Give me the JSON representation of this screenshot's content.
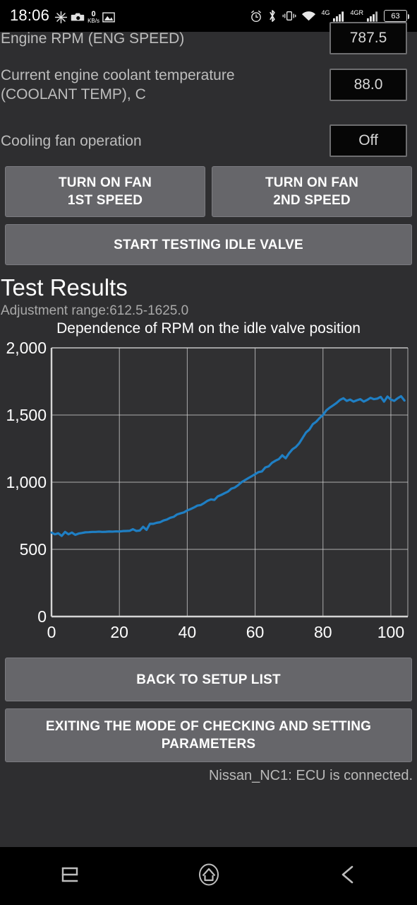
{
  "statusbar": {
    "time": "18:06",
    "network_speed_value": "0",
    "network_speed_unit": "KB/s",
    "battery_percent": "63",
    "mobile_label_1": "4G",
    "mobile_label_2": "4GR",
    "icons": [
      "burst-icon",
      "camera-icon",
      "network-speed-icon",
      "image-icon",
      "alarm-icon",
      "bluetooth-icon",
      "vibrate-icon",
      "wifi-icon",
      "signal-bars-icon",
      "battery-icon"
    ]
  },
  "params": [
    {
      "label": "Engine RPM (ENG SPEED)",
      "value": "787.5"
    },
    {
      "label": "Current engine coolant temperature (COOLANT TEMP), C",
      "value": "88.0"
    },
    {
      "label": "Cooling fan operation",
      "value": "Off"
    }
  ],
  "buttons": {
    "fan1_line1": "TURN ON FAN",
    "fan1_line2": "1ST SPEED",
    "fan2_line1": "TURN ON FAN",
    "fan2_line2": "2ND SPEED",
    "start_test": "START TESTING IDLE VALVE",
    "back_to_setup": "BACK TO SETUP LIST",
    "exit_line1": "EXITING THE MODE OF CHECKING AND SETTING",
    "exit_line2": "PARAMETERS"
  },
  "results": {
    "title": "Test Results",
    "adjustment_range": "Adjustment range:612.5-1625.0"
  },
  "footer": {
    "status": "Nissan_NC1: ECU is connected."
  },
  "navbar": {
    "recents": "recents-icon",
    "home": "home-icon",
    "back": "back-icon"
  },
  "colors": {
    "background": "#2e2e30",
    "button": "#66666a",
    "line": "#1f7fc4",
    "plot_bg": "#303032",
    "axis": "#d5d5d5"
  },
  "chart_data": {
    "type": "line",
    "title": "Dependence of RPM on the idle valve position",
    "xlabel": "",
    "ylabel": "",
    "xlim": [
      0,
      105
    ],
    "ylim": [
      0,
      2000
    ],
    "xticks": [
      0,
      20,
      40,
      60,
      80,
      100
    ],
    "yticks": [
      0,
      500,
      1000,
      1500,
      2000
    ],
    "ytick_labels": [
      "0",
      "500",
      "1,000",
      "1,500",
      "2,000"
    ],
    "xtick_labels": [
      "0",
      "20",
      "40",
      "60",
      "80",
      "100"
    ],
    "grid": true,
    "legend": "none",
    "series": [
      {
        "name": "RPM",
        "x": [
          0,
          1,
          2,
          3,
          4,
          5,
          6,
          7,
          8,
          9,
          10,
          11,
          12,
          13,
          14,
          15,
          16,
          17,
          18,
          19,
          20,
          21,
          22,
          23,
          24,
          25,
          26,
          27,
          28,
          29,
          30,
          31,
          32,
          33,
          34,
          35,
          36,
          37,
          38,
          39,
          40,
          41,
          42,
          43,
          44,
          45,
          46,
          47,
          48,
          49,
          50,
          51,
          52,
          53,
          54,
          55,
          56,
          57,
          58,
          59,
          60,
          61,
          62,
          63,
          64,
          65,
          66,
          67,
          68,
          69,
          70,
          71,
          72,
          73,
          74,
          75,
          76,
          77,
          78,
          79,
          80,
          81,
          82,
          83,
          84,
          85,
          86,
          87,
          88,
          89,
          90,
          91,
          92,
          93,
          94,
          95,
          96,
          97,
          98,
          99,
          100,
          101,
          102,
          103,
          104
        ],
        "y": [
          625,
          612,
          620,
          600,
          630,
          612,
          625,
          608,
          618,
          622,
          627,
          628,
          630,
          630,
          632,
          630,
          631,
          633,
          632,
          634,
          633,
          636,
          637,
          638,
          650,
          637,
          640,
          668,
          645,
          690,
          690,
          698,
          702,
          715,
          722,
          735,
          742,
          760,
          768,
          775,
          790,
          800,
          812,
          826,
          830,
          845,
          862,
          872,
          868,
          895,
          905,
          918,
          930,
          952,
          960,
          978,
          1000,
          1015,
          1030,
          1045,
          1060,
          1075,
          1080,
          1110,
          1118,
          1145,
          1160,
          1172,
          1200,
          1178,
          1215,
          1245,
          1262,
          1290,
          1330,
          1370,
          1392,
          1432,
          1450,
          1478,
          1500,
          1535,
          1555,
          1572,
          1590,
          1612,
          1625,
          1605,
          1615,
          1600,
          1610,
          1618,
          1600,
          1612,
          1628,
          1618,
          1622,
          1635,
          1600,
          1638,
          1615,
          1605,
          1625,
          1640,
          1608,
          1625
        ],
        "color": "#1f7fc4"
      }
    ]
  }
}
